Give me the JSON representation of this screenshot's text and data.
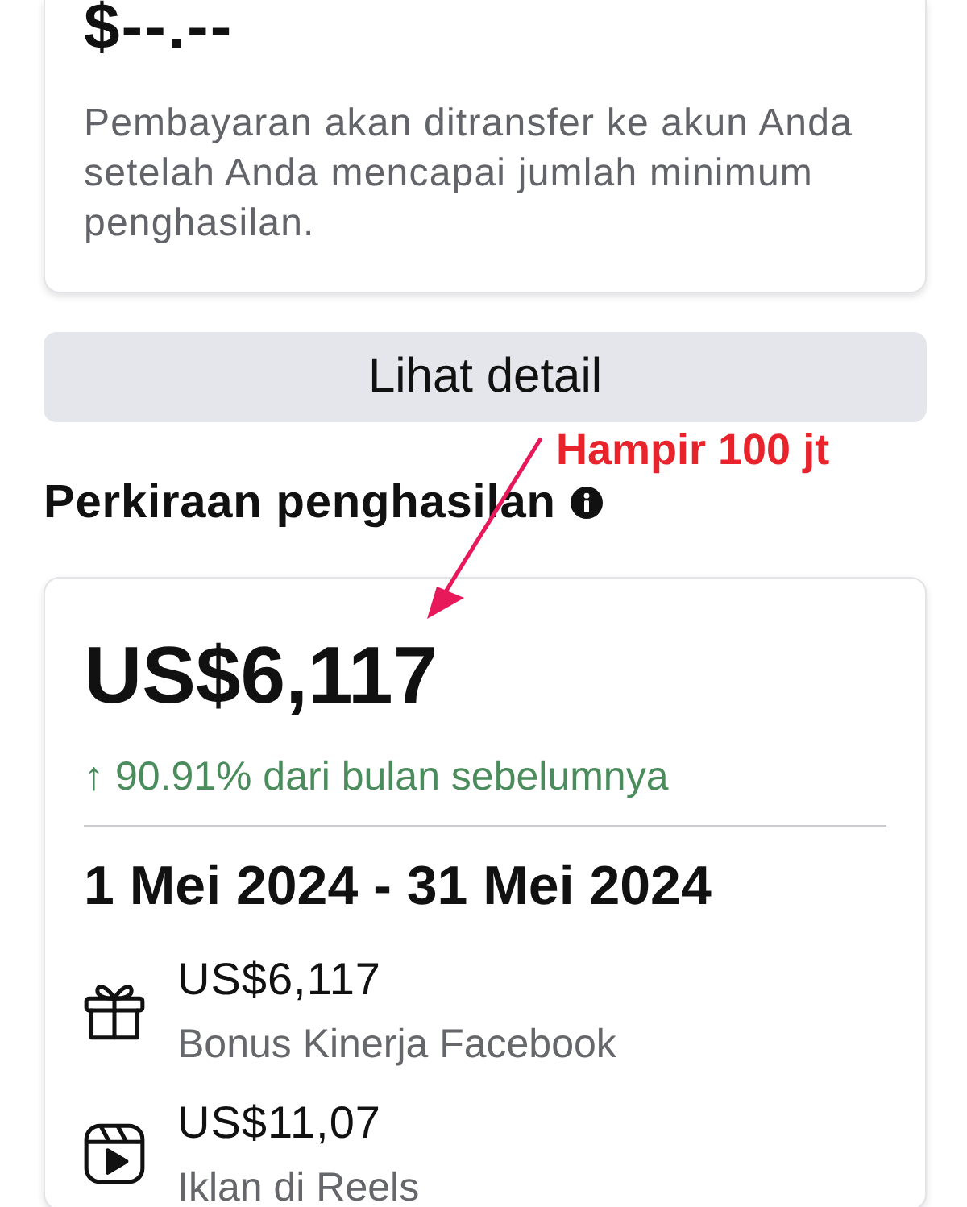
{
  "payout_card": {
    "amount": "$--.--",
    "description": "Pembayaran akan ditransfer ke akun Anda setelah Anda mencapai jumlah minimum penghasilan."
  },
  "details_button": {
    "label": "Lihat detail"
  },
  "annotation": {
    "text": "Hampir 100 jt"
  },
  "estimated_earnings": {
    "title": "Perkiraan penghasilan",
    "total": "US$6,117",
    "change": "↑ 90.91% dari bulan sebelumnya",
    "period": "1 Mei 2024 - 31 Mei 2024",
    "items": [
      {
        "kind": "gift",
        "amount": "US$6,117",
        "label": "Bonus Kinerja Facebook"
      },
      {
        "kind": "reels",
        "amount": "US$11,07",
        "label": "Iklan di Reels"
      }
    ]
  }
}
